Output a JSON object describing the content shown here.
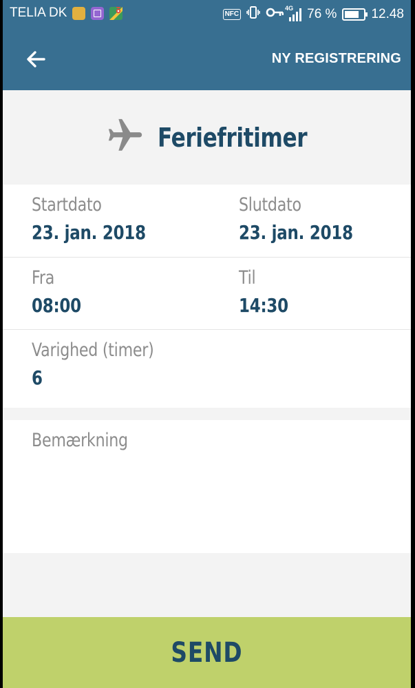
{
  "status_bar": {
    "carrier": "TELIA DK",
    "nfc": "NFC",
    "network": "4G",
    "battery_text": "76 %",
    "battery_level": 0.76,
    "time": "12.48",
    "icons": [
      "notification-yellow-icon",
      "gallery-icon",
      "maps-icon",
      "nfc-icon",
      "vibrate-icon",
      "key-icon",
      "signal-icon",
      "battery-icon"
    ]
  },
  "app_bar": {
    "back_icon": "arrow-left-icon",
    "action_label": "NY REGISTRERING"
  },
  "header": {
    "icon": "airplane-icon",
    "title": "Feriefritimer"
  },
  "form": {
    "start_date": {
      "label": "Startdato",
      "value": "23. jan. 2018"
    },
    "end_date": {
      "label": "Slutdato",
      "value": "23. jan. 2018"
    },
    "from": {
      "label": "Fra",
      "value": "08:00"
    },
    "to": {
      "label": "Til",
      "value": "14:30"
    },
    "duration": {
      "label": "Varighed (timer)",
      "value": "6"
    },
    "remark": {
      "placeholder": "Bemærkning",
      "value": ""
    }
  },
  "send_label": "SEND",
  "colors": {
    "primary": "#386f91",
    "text_dark": "#1e4a66",
    "label_gray": "#8c8c8c",
    "send_green": "#bfd16b",
    "background": "#f3f3f3"
  }
}
